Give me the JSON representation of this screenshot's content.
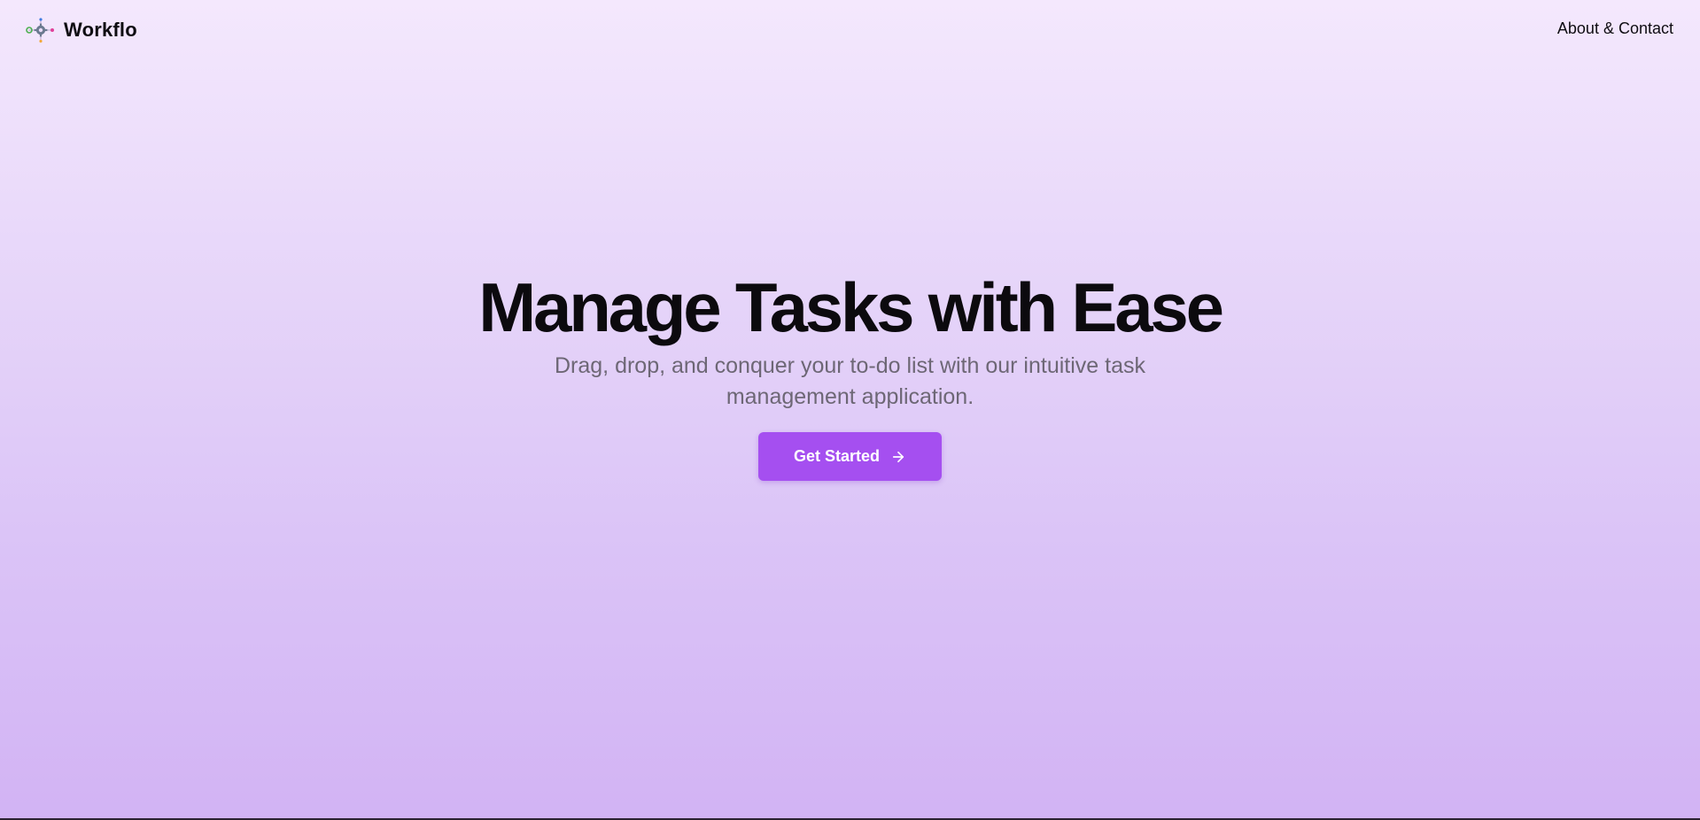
{
  "header": {
    "brand_name": "Workflo",
    "logo_icon": "gear-network-icon",
    "nav_link": "About & Contact"
  },
  "hero": {
    "title": "Manage Tasks with Ease",
    "subtitle": "Drag, drop, and conquer your to-do list with our intuitive task management application.",
    "cta_label": "Get Started",
    "cta_icon": "arrow-right-icon"
  },
  "colors": {
    "accent": "#a54ff0",
    "background_top": "#f4e8fd",
    "background_bottom": "#d2b3f4",
    "title_text": "#0c0a0e",
    "subtitle_text": "#6d6775"
  }
}
